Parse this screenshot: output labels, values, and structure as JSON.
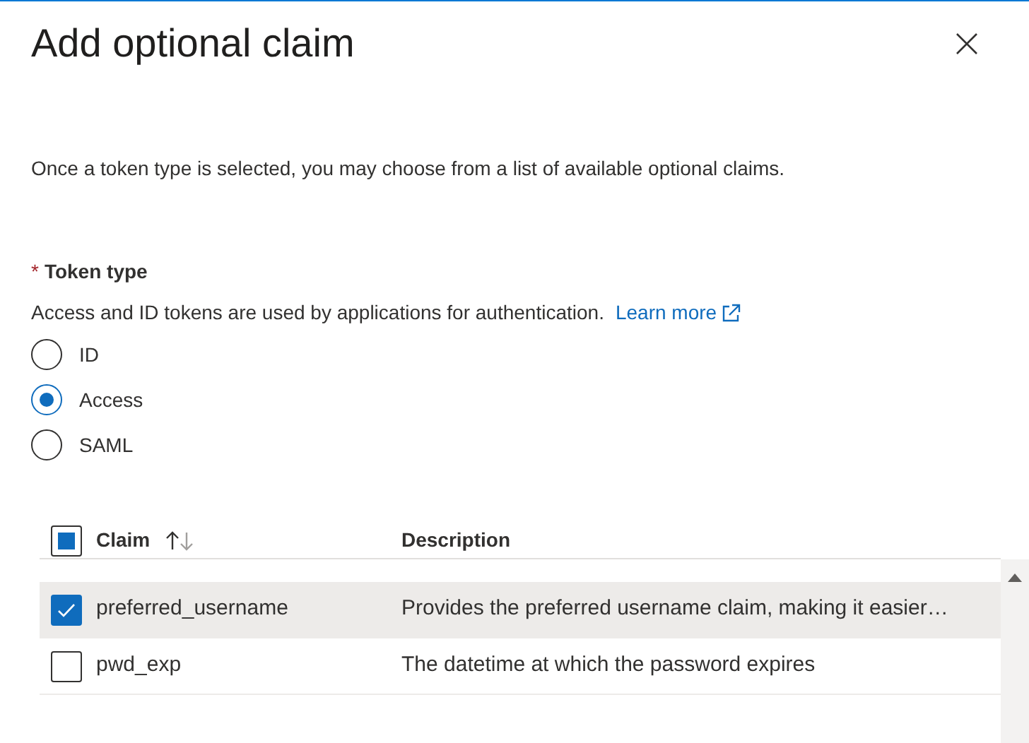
{
  "panel": {
    "title": "Add optional claim",
    "intro": "Once a token type is selected, you may choose from a list of available optional claims."
  },
  "token_type": {
    "label": "Token type",
    "required_mark": "*",
    "help": "Access and ID tokens are used by applications for authentication.",
    "link": "Learn more",
    "options": [
      {
        "label": "ID",
        "selected": false
      },
      {
        "label": "Access",
        "selected": true
      },
      {
        "label": "SAML",
        "selected": false
      }
    ]
  },
  "table": {
    "header_checkbox": {
      "indeterminate": true
    },
    "columns": [
      {
        "label": "Claim",
        "sortable": true
      },
      {
        "label": "Description",
        "sortable": false
      }
    ],
    "rows": [
      {
        "claim": "preferred_username",
        "description": "Provides the preferred username claim, making it easier…",
        "checked": true
      },
      {
        "claim": "pwd_exp",
        "description": "The datetime at which the password expires",
        "checked": false
      }
    ]
  }
}
